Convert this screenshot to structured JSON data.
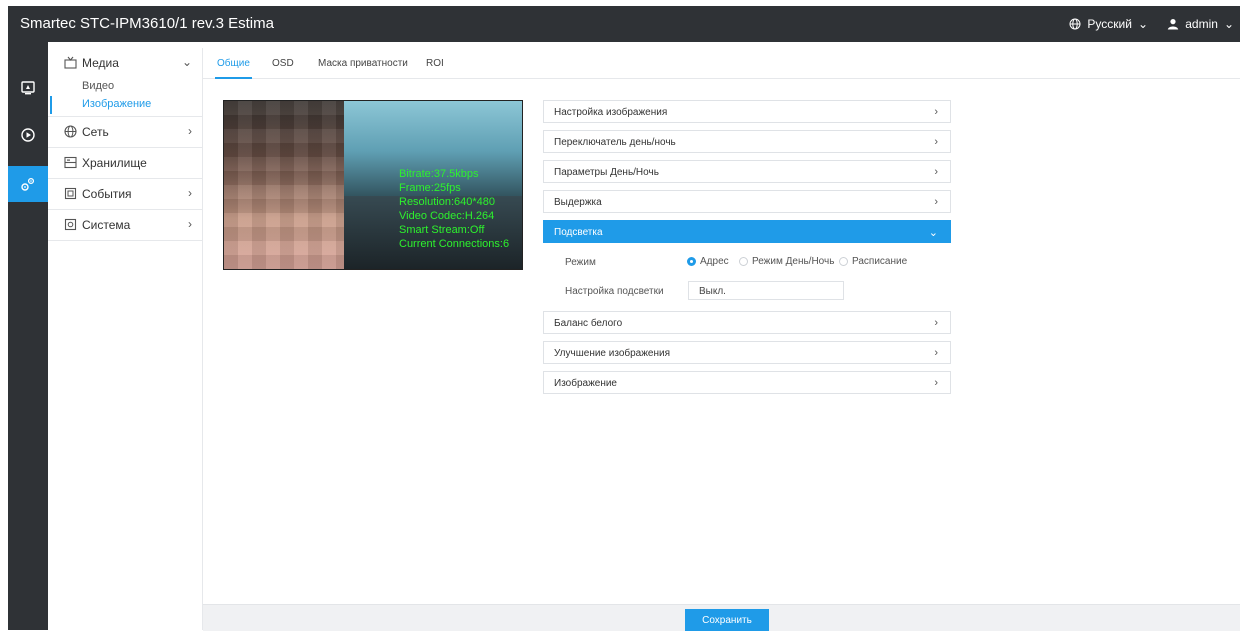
{
  "header": {
    "title": "Smartec STC-IPM3610/1 rev.3 Estima",
    "language": "Русский",
    "user": "admin"
  },
  "rail": {
    "items": [
      {
        "icon": "live-view-icon",
        "active": false
      },
      {
        "icon": "playback-icon",
        "active": false
      },
      {
        "icon": "settings-gears-icon",
        "active": true
      }
    ]
  },
  "nav": {
    "media": {
      "label": "Медиа",
      "sub": [
        "Видео",
        "Изображение"
      ]
    },
    "network": "Сеть",
    "storage": "Хранилище",
    "events": "События",
    "system": "Система"
  },
  "tabs": [
    "Общие",
    "OSD",
    "Маска приватности",
    "ROI"
  ],
  "preview": {
    "overlay": "Bitrate:37.5kbps\nFrame:25fps\nResolution:640*480\nVideo Codec:H.264\nSmart Stream:Off\nCurrent Connections:6"
  },
  "accordion": {
    "items": [
      "Настройка изображения",
      "Переключатель день/ночь",
      "Параметры День/Ночь",
      "Выдержка",
      "Подсветка",
      "Баланс белого",
      "Улучшение изображения",
      "Изображение"
    ],
    "open_index": 4,
    "detail": {
      "mode_label": "Режим",
      "mode_options": [
        "Адрес",
        "Режим День/Ночь",
        "Расписание"
      ],
      "mode_selected": "Адрес",
      "backlight_label": "Настройка подсветки",
      "backlight_value": "Выкл."
    }
  },
  "footer": {
    "save": "Сохранить"
  },
  "colors": {
    "accent": "#1f9be8",
    "chrome": "#2f3236"
  }
}
